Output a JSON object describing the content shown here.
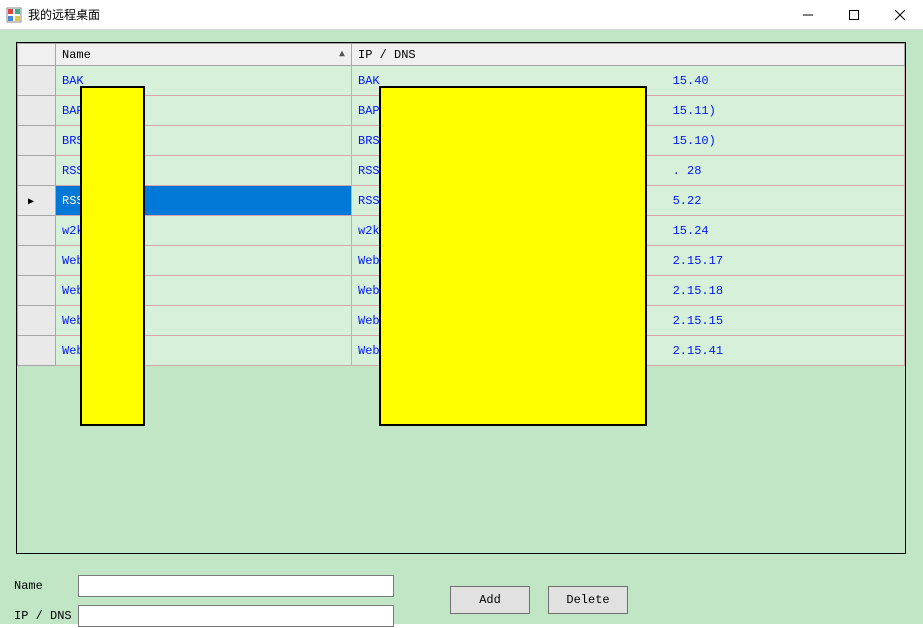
{
  "window": {
    "title": "我的远程桌面"
  },
  "grid": {
    "columns": {
      "name": "Name",
      "ip": "IP / DNS"
    },
    "rows": [
      {
        "name": "BAK",
        "ip_left": "BAK",
        "ip_right": "15.40",
        "selected": false
      },
      {
        "name": "BAP",
        "ip_left": "BAP",
        "ip_right": "15.11)",
        "selected": false
      },
      {
        "name": "BRS",
        "ip_left": "BRS",
        "ip_right": "15.10)",
        "selected": false
      },
      {
        "name": "RSS",
        "ip_left": "RSS",
        "ip_right": ". 28",
        "selected": false
      },
      {
        "name": "RSS",
        "ip_left": "RSS",
        "ip_right": "5.22",
        "selected": true
      },
      {
        "name": "w2k",
        "ip_left": "w2k",
        "ip_right": "15.24",
        "selected": false
      },
      {
        "name": "Web",
        "ip_left": "Web",
        "ip_right": "2.15.17",
        "selected": false
      },
      {
        "name": "Web",
        "ip_left": "Web",
        "ip_right": "2.15.18",
        "selected": false
      },
      {
        "name": "Web",
        "ip_left": "Web",
        "ip_right": "2.15.15",
        "selected": false
      },
      {
        "name": "Web",
        "ip_left": "Web",
        "ip_right": "2.15.41",
        "selected": false
      }
    ]
  },
  "form": {
    "name_label": "Name",
    "name_value": "",
    "ip_label": "IP / DNS",
    "ip_value": ""
  },
  "buttons": {
    "add": "Add",
    "delete": "Delete"
  }
}
